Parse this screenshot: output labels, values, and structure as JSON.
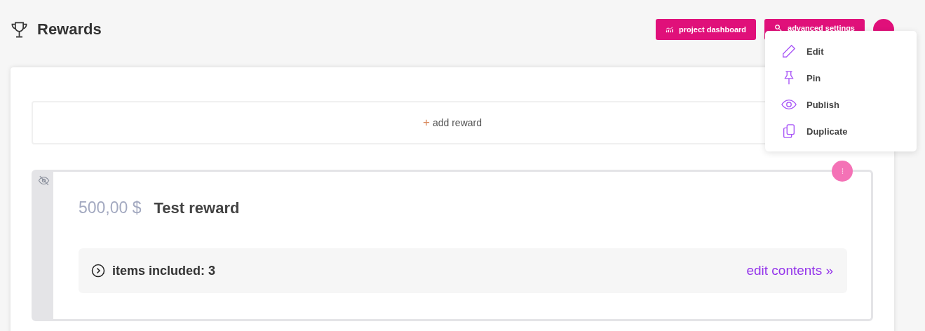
{
  "page": {
    "title": "Rewards"
  },
  "header_buttons": [
    {
      "kind": "dashboard",
      "label": "project dashboard"
    },
    {
      "kind": "settings",
      "label": "advanced settings"
    },
    {
      "kind": "help"
    }
  ],
  "add_reward": {
    "icon": "+",
    "label": "add reward"
  },
  "reward": {
    "published": false,
    "price": "500,00 $",
    "title": "Test reward",
    "items_label": "items included: 3",
    "expanded": false,
    "edit_link": "edit contents »"
  },
  "menu": {
    "items": [
      {
        "kind": "edit",
        "label": "Edit"
      },
      {
        "kind": "pin",
        "label": "Pin"
      },
      {
        "kind": "publish",
        "label": "Publish"
      },
      {
        "kind": "duplicate",
        "label": "Duplicate"
      }
    ]
  }
}
